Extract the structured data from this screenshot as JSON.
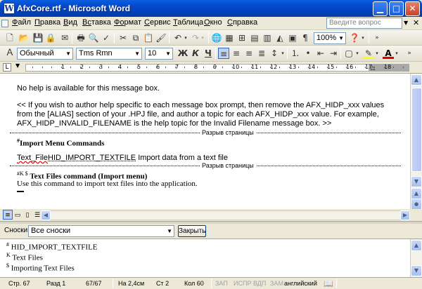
{
  "window": {
    "title": "AfxCore.rtf - Microsoft Word",
    "app_icon": "W"
  },
  "menu": {
    "items": [
      {
        "u": "Ф",
        "rest": "айл"
      },
      {
        "u": "П",
        "rest": "равка"
      },
      {
        "u": "В",
        "rest": "ид"
      },
      {
        "u": "Вс",
        "rest": "тавка"
      },
      {
        "u": "Фо",
        "rest": "рмат"
      },
      {
        "u": "С",
        "rest": "ервис"
      },
      {
        "u": "Т",
        "rest": "аблица"
      },
      {
        "u": "О",
        "rest": "кно"
      },
      {
        "u": "С",
        "rest": "правка"
      }
    ],
    "help_placeholder": "Введите вопрос"
  },
  "toolbar": {
    "zoom": "100%",
    "zoom_arrow": "▾"
  },
  "format_bar": {
    "style": "Обычный",
    "font": "Tms Rmn",
    "size": "10",
    "bold": "Ж",
    "italic": "К",
    "underline": "Ч"
  },
  "ruler": {
    "marks": [
      "1",
      "2",
      "3",
      "4",
      "5",
      "6",
      "7",
      "8",
      "9",
      "10",
      "11",
      "12",
      "13",
      "14",
      "15",
      "16",
      "17",
      "18"
    ]
  },
  "document": {
    "line1": "No help is available for this message box.",
    "para2": [
      "<< If you wish to author help specific to each message box prompt, then remove the AFX_HIDP_xxx values",
      "from the [ALIAS] section of your .HPJ file, and author a topic for each AFX_HIDP_xxx value.  For example,",
      "AFX_HIDP_INVALID_FILENAME is the help topic for the Invalid Filename message box. >>"
    ],
    "page_break": "Разрыв страницы",
    "heading1_mark": "#",
    "heading1": "Import Menu Commands",
    "text_file_link": "Text_File",
    "hid_import": "HID_IMPORT_TEXTFILE",
    "text_file_desc": "  Import data from a text file",
    "heading2_marks": "#K $",
    "heading2": " Text Files command (Import menu)",
    "line_use": "Use this command to import text files into the application."
  },
  "footnote_bar": {
    "label": "Сноски",
    "selected": "Все сноски",
    "close_button": "Закрыть"
  },
  "footnotes": [
    {
      "mark": "#",
      "text": " HID_IMPORT_TEXTFILE"
    },
    {
      "mark": "K",
      "text": " Text Files"
    },
    {
      "mark": "$",
      "text": " Importing Text Files"
    }
  ],
  "status": {
    "page": "Стр. 67",
    "section": "Разд 1",
    "pages": "67/67",
    "at": "На 2,4см",
    "line": "Ст 2",
    "col": "Кол 60",
    "rec": "ЗАП",
    "trk": "ИСПР",
    "ext": "ВДП",
    "ovr": "ЗАМ",
    "language": "английский"
  }
}
